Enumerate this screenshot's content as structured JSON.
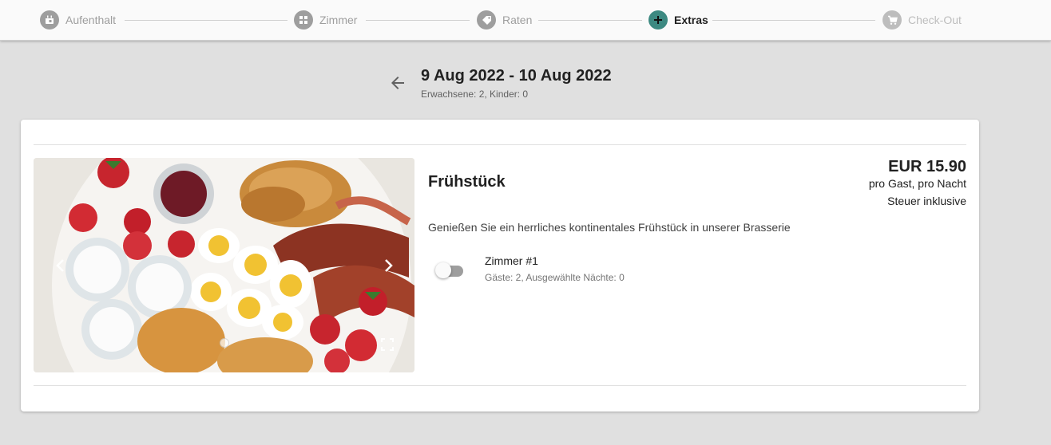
{
  "stepper": {
    "steps": [
      {
        "label": "Aufenthalt",
        "icon": "calendar-icon",
        "state": "done"
      },
      {
        "label": "Zimmer",
        "icon": "grid-icon",
        "state": "done"
      },
      {
        "label": "Raten",
        "icon": "tag-icon",
        "state": "done"
      },
      {
        "label": "Extras",
        "icon": "plus-icon",
        "state": "active"
      },
      {
        "label": "Check-Out",
        "icon": "cart-icon",
        "state": "disabled"
      }
    ],
    "colors": {
      "active": "#3c8981",
      "done": "#9e9e9e",
      "disabled": "#bdbdbd"
    }
  },
  "header": {
    "date_range": "9 Aug 2022 - 10 Aug 2022",
    "guests": "Erwachsene: 2, Kinder: 0"
  },
  "extra": {
    "title": "Frühstück",
    "price": "EUR 15.90",
    "price_unit": "pro Gast, pro Nacht",
    "tax_note": "Steuer inklusive",
    "description": "Genießen Sie ein herrliches kontinentales Frühstück in unserer Brasserie",
    "image_alt": "breakfast-plate-photo",
    "room": {
      "name": "Zimmer #1",
      "details": "Gäste: 2, Ausgewählte Nächte: 0",
      "selected": false
    }
  }
}
